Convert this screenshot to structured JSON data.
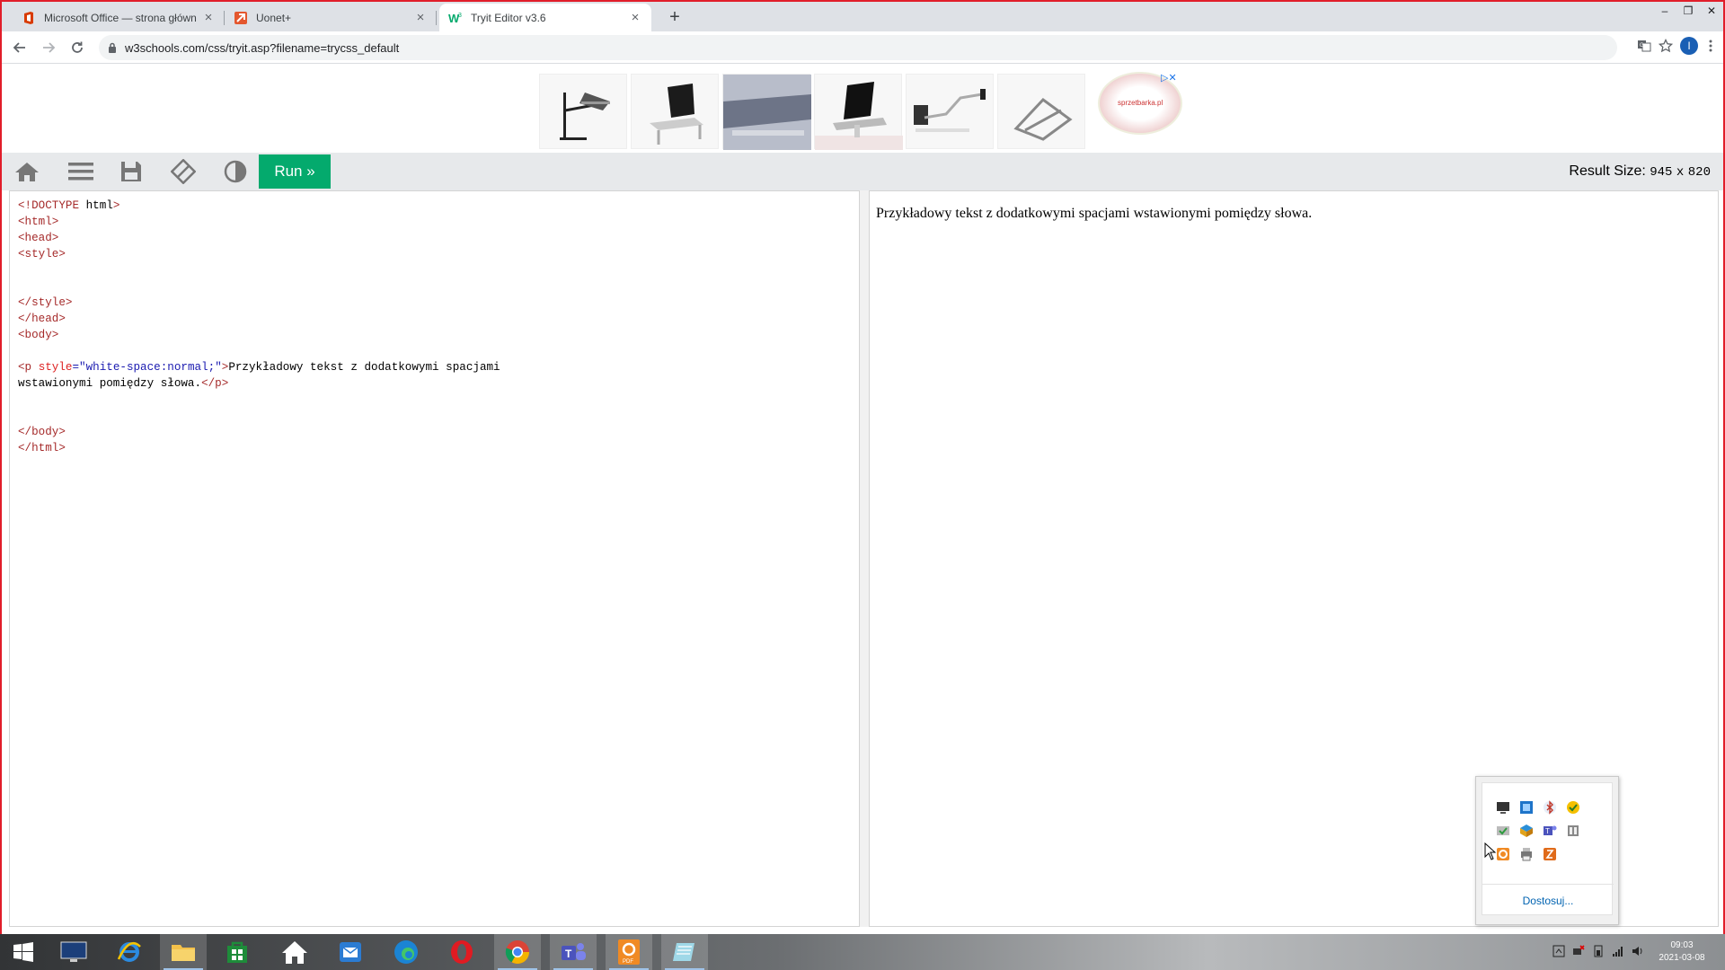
{
  "browser": {
    "tabs": [
      {
        "title": "Microsoft Office — strona główn",
        "active": false
      },
      {
        "title": "Uonet+",
        "active": false
      },
      {
        "title": "Tryit Editor v3.6",
        "active": true
      }
    ],
    "new_tab_symbol": "+",
    "window_controls": [
      "–",
      "❐",
      "✕"
    ],
    "url": "w3schools.com/css/tryit.asp?filename=trycss_default",
    "profile_initial": "I"
  },
  "ad": {
    "label": "▷✕",
    "logo_text": "sprzetbarka.pl"
  },
  "w3toolbar": {
    "icons": [
      "home-icon",
      "menu-icon",
      "save-icon",
      "rotate-icon",
      "contrast-icon"
    ],
    "run_label": "Run »",
    "result_size_label": "Result Size:",
    "result_width": "945",
    "result_x": "x",
    "result_height": "820"
  },
  "code": {
    "lines": [
      "<!DOCTYPE html>",
      "<html>",
      "<head>",
      "<style>",
      "",
      "",
      "</style>",
      "</head>",
      "<body>",
      "",
      "<p style=\"white-space:normal;\">Przykładowy tekst z dodatkowymi spacjami",
      "wstawionymi pomiędzy słowa.</p>",
      "",
      "",
      "</body>",
      "</html>"
    ]
  },
  "result": {
    "text": "Przykładowy tekst z dodatkowymi spacjami wstawionymi pomiędzy słowa."
  },
  "tray_popup": {
    "icons": [
      "monitor-icon",
      "network-icon",
      "bluetooth-icon",
      "update-icon",
      "security-icon",
      "package-icon",
      "teams-icon",
      "hardware-icon",
      "pdf-tray-icon",
      "printer-icon",
      "app-icon"
    ],
    "customize_label": "Dostosuj..."
  },
  "taskbar": {
    "apps": [
      "start-button",
      "lenovo-icon",
      "internet-explorer-icon",
      "file-explorer-icon",
      "store-icon",
      "home-icon",
      "mail-icon",
      "edge-icon",
      "opera-icon",
      "chrome-icon",
      "teams-icon",
      "pdf-icon",
      "notepad-icon"
    ],
    "time": "09:03",
    "date": "2021-03-08"
  },
  "colors": {
    "run_button": "#04aa6d",
    "frame_border": "#e11d2a",
    "link": "#0063b1"
  }
}
